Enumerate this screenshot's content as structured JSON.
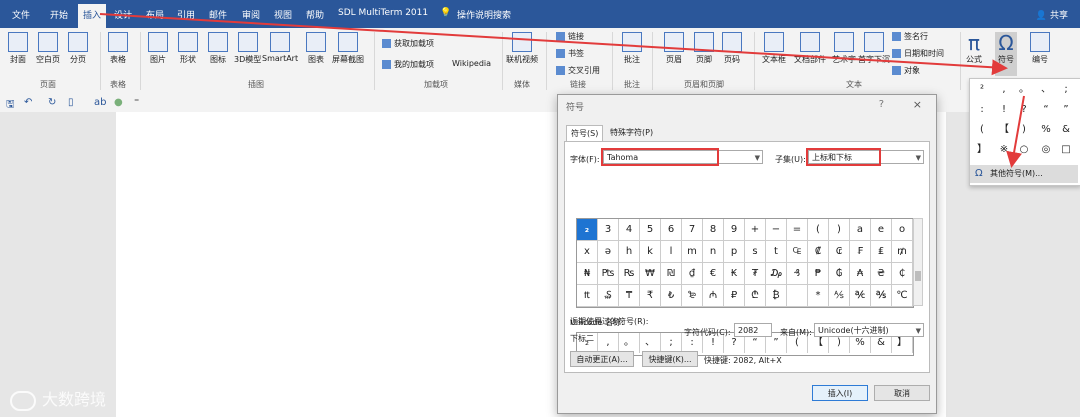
{
  "tabs": [
    "文件",
    "开始",
    "插入",
    "设计",
    "布局",
    "引用",
    "邮件",
    "审阅",
    "视图",
    "帮助",
    "SDL MultiTerm 2011",
    "操作说明搜索"
  ],
  "share": "共享",
  "ribbon": {
    "buttons": [
      "封面",
      "空白页",
      "分页",
      "表格",
      "图片",
      "形状",
      "图标",
      "3D模型",
      "SmartArt",
      "图表",
      "屏幕截图",
      "联机视频",
      "批注",
      "页眉",
      "页脚",
      "页码",
      "文本框",
      "文档部件",
      "艺术字",
      "首字下沉",
      "公式",
      "符号",
      "编号"
    ],
    "small": [
      "获取加载项",
      "我的加载项",
      "Wikipedia",
      "链接",
      "书签",
      "交叉引用",
      "签名行",
      "日期和时间",
      "对象"
    ],
    "groups": [
      "页面",
      "表格",
      "插图",
      "加载项",
      "媒体",
      "链接",
      "批注",
      "页眉和页脚",
      "文本"
    ]
  },
  "symbol_dropdown": {
    "cells": [
      "²",
      ",",
      "。",
      "、",
      ";",
      ":",
      "!",
      "?",
      "“",
      "”",
      "(",
      "【",
      ")",
      "%",
      "&",
      "】",
      "※",
      "○",
      "◎",
      "□"
    ],
    "more": "其他符号(M)..."
  },
  "dialog": {
    "title": "符号",
    "help": "?",
    "close": "×",
    "tab_symbols": "符号(S)",
    "tab_special": "特殊字符(P)",
    "font_label": "字体(F):",
    "font_value": "Tahoma",
    "subset_label": "子集(U):",
    "subset_value": "上标和下标",
    "grid": [
      [
        "₂",
        "3",
        "4",
        "5",
        "6",
        "7",
        "8",
        "9",
        "+",
        "−",
        "=",
        "(",
        ")",
        "a",
        "e",
        "o"
      ],
      [
        "x",
        "ə",
        "h",
        "k",
        "l",
        "m",
        "n",
        "p",
        "s",
        "t",
        "₠",
        "₡",
        "₢",
        "₣",
        "₤",
        "₥"
      ],
      [
        "₦",
        "₧",
        "₨",
        "₩",
        "₪",
        "₫",
        "€",
        "₭",
        "₮",
        "₯",
        "₰",
        "₱",
        "₲",
        "₳",
        "₴",
        "₵"
      ],
      [
        "₶",
        "₷",
        "₸",
        "₹",
        "₺",
        "₻",
        "₼",
        "₽",
        "₾",
        "₿",
        "",
        "*",
        "⅍",
        "℀",
        "℁",
        "℃"
      ]
    ],
    "recent_label": "近期使用过的符号(R):",
    "recent": [
      "₂",
      ",",
      "。",
      "、",
      ";",
      ":",
      "!",
      "?",
      "“",
      "”",
      "(",
      "【",
      ")",
      "%",
      "&",
      "】"
    ],
    "unicode_name_label": "Unicode 名称:",
    "unicode_name": "下标二",
    "code_label": "字符代码(C):",
    "code_value": "2082",
    "from_label": "来自(M):",
    "from_value": "Unicode(十六进制)",
    "autocorrect_btn": "自动更正(A)...",
    "shortcut_btn": "快捷键(K)...",
    "shortcut_text": "快捷键: 2082, Alt+X",
    "insert_btn": "插入(I)",
    "cancel_btn": "取消"
  },
  "watermark": "大数跨境",
  "colors": {
    "accent": "#2b579a",
    "highlight": "#e23b3b",
    "selected": "#1e74d2"
  }
}
